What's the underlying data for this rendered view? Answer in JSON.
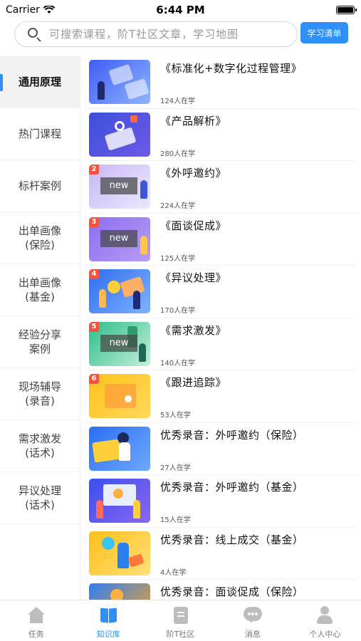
{
  "status_bar": {
    "carrier": "Carrier",
    "time": "6:44 PM"
  },
  "search": {
    "placeholder": "可搜索课程，阶T社区文章，学习地图",
    "value": ""
  },
  "study_list_button": "学习清单",
  "sidebar": {
    "items": [
      {
        "label": "通用原理",
        "active": true
      },
      {
        "label": "热门课程",
        "active": false
      },
      {
        "label": "标杆案例",
        "active": false
      },
      {
        "label": "出单画像\n(保险)",
        "active": false
      },
      {
        "label": "出单画像\n(基金)",
        "active": false
      },
      {
        "label": "经验分享\n案例",
        "active": false
      },
      {
        "label": "现场辅导\n(录音)",
        "active": false
      },
      {
        "label": "需求激发\n(话术)",
        "active": false
      },
      {
        "label": "异议处理\n(话术)",
        "active": false
      }
    ]
  },
  "courses": [
    {
      "title": "《标准化+数字化过程管理》",
      "count": "124人在学",
      "rank": "",
      "badge": ""
    },
    {
      "title": "《产品解析》",
      "count": "280人在学",
      "rank": "",
      "badge": ""
    },
    {
      "title": "《外呼邀约》",
      "count": "224人在学",
      "rank": "2",
      "badge": "new"
    },
    {
      "title": "《面谈促成》",
      "count": "125人在学",
      "rank": "3",
      "badge": "new"
    },
    {
      "title": "《异议处理》",
      "count": "170人在学",
      "rank": "4",
      "badge": ""
    },
    {
      "title": "《需求激发》",
      "count": "140人在学",
      "rank": "5",
      "badge": "new"
    },
    {
      "title": "《跟进追踪》",
      "count": "53人在学",
      "rank": "6",
      "badge": ""
    },
    {
      "title": "优秀录音：外呼邀约（保险）",
      "count": "27人在学",
      "rank": "",
      "badge": ""
    },
    {
      "title": "优秀录音：外呼邀约（基金）",
      "count": "15人在学",
      "rank": "",
      "badge": ""
    },
    {
      "title": "优秀录音：线上成交（基金）",
      "count": "4人在学",
      "rank": "",
      "badge": ""
    },
    {
      "title": "优秀录音：面谈促成（保险）",
      "count": "",
      "rank": "",
      "badge": ""
    }
  ],
  "tabbar": {
    "tabs": [
      {
        "label": "任务",
        "icon": "home-icon",
        "active": false
      },
      {
        "label": "知识库",
        "icon": "book-icon",
        "active": true
      },
      {
        "label": "阶T社区",
        "icon": "document-icon",
        "active": false
      },
      {
        "label": "消息",
        "icon": "chat-icon",
        "active": false
      },
      {
        "label": "个人中心",
        "icon": "user-icon",
        "active": false
      }
    ]
  },
  "colors": {
    "accent": "#2e8ff6",
    "rank_badge": "#f5533e",
    "inactive_icon": "#bdbdbd"
  }
}
